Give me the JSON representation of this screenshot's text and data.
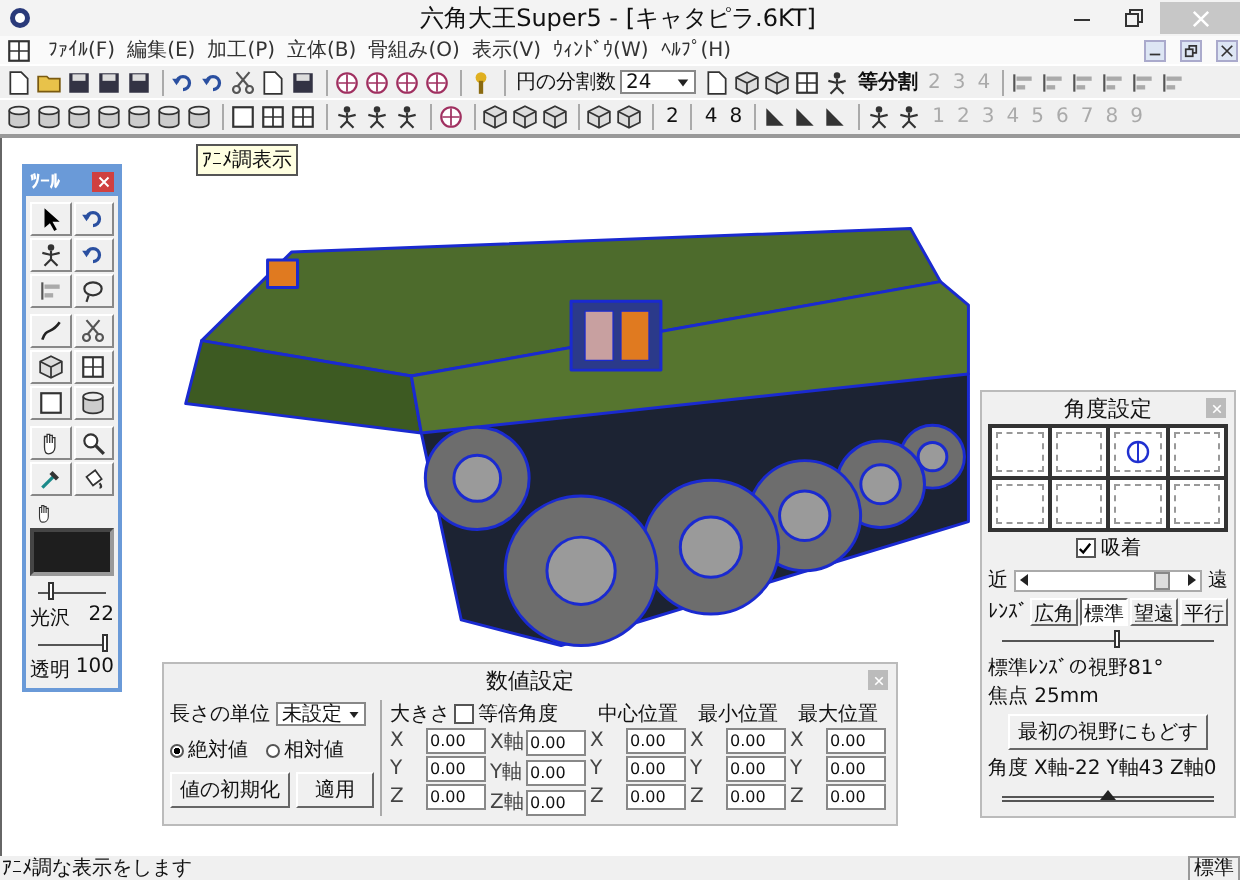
{
  "window": {
    "title": "六角大王Super5 - [キャタピラ.6KT]"
  },
  "menu": [
    "ﾌｧｲﾙ(F)",
    "編集(E)",
    "加工(P)",
    "立体(B)",
    "骨組み(O)",
    "表示(V)",
    "ｳｨﾝﾄﾞｳ(W)",
    "ﾍﾙﾌﾟ(H)"
  ],
  "toolbar_1": {
    "division_label": "円の分割数",
    "division_value": "24",
    "equal_split_label": "等分割",
    "split_buttons": [
      {
        "label": "2",
        "disabled": true
      },
      {
        "label": "3",
        "disabled": true
      },
      {
        "label": "4",
        "disabled": true
      }
    ]
  },
  "toolbar_2": {
    "count_buttons": [
      {
        "label": "2",
        "disabled": false
      },
      {
        "label": "4",
        "disabled": false
      },
      {
        "label": "8",
        "disabled": false
      }
    ],
    "number_buttons": [
      {
        "label": "1",
        "disabled": true
      },
      {
        "label": "2",
        "disabled": true
      },
      {
        "label": "3",
        "disabled": true
      },
      {
        "label": "4",
        "disabled": true
      },
      {
        "label": "5",
        "disabled": true
      },
      {
        "label": "6",
        "disabled": true
      },
      {
        "label": "7",
        "disabled": true
      },
      {
        "label": "8",
        "disabled": true
      },
      {
        "label": "9",
        "disabled": true
      }
    ]
  },
  "tooltip": "ｱﾆﾒ調表示",
  "tool_palette": {
    "title": "ﾂｰﾙ",
    "sliders": [
      {
        "label": "光沢",
        "reading": "22",
        "level": 0.22
      },
      {
        "label": "透明",
        "reading": "100",
        "level": 1
      }
    ]
  },
  "numeric_dialog": {
    "title": "数値設定",
    "unit_label": "長さの単位",
    "unit_value": "未設定",
    "modes": [
      {
        "label": "絶対値",
        "selected": true
      },
      {
        "label": "相対値",
        "selected": false
      }
    ],
    "buttons": [
      "値の初期化",
      "適用"
    ],
    "uniform_scale": {
      "label": "等倍",
      "checked": false
    },
    "columns": [
      {
        "header": "大きさ",
        "fields": [
          {
            "axis": "X",
            "value": "0.00"
          },
          {
            "axis": "Y",
            "value": "0.00"
          },
          {
            "axis": "Z",
            "value": "0.00"
          }
        ]
      },
      {
        "header": "角度",
        "fields": [
          {
            "axis": "X軸",
            "value": "0.00"
          },
          {
            "axis": "Y軸",
            "value": "0.00"
          },
          {
            "axis": "Z軸",
            "value": "0.00"
          }
        ]
      },
      {
        "header": "中心位置",
        "fields": [
          {
            "axis": "X",
            "value": "0.00"
          },
          {
            "axis": "Y",
            "value": "0.00"
          },
          {
            "axis": "Z",
            "value": "0.00"
          }
        ]
      },
      {
        "header": "最小位置",
        "fields": [
          {
            "axis": "X",
            "value": "0.00"
          },
          {
            "axis": "Y",
            "value": "0.00"
          },
          {
            "axis": "Z",
            "value": "0.00"
          }
        ]
      },
      {
        "header": "最大位置",
        "fields": [
          {
            "axis": "X",
            "value": "0.00"
          },
          {
            "axis": "Y",
            "value": "0.00"
          },
          {
            "axis": "Z",
            "value": "0.00"
          }
        ]
      }
    ]
  },
  "angle_dialog": {
    "title": "角度設定",
    "views": [
      {
        "selected": false
      },
      {
        "selected": false
      },
      {
        "selected": true
      },
      {
        "selected": false
      },
      {
        "selected": false
      },
      {
        "selected": false
      },
      {
        "selected": false
      },
      {
        "selected": false
      }
    ],
    "snap": {
      "label": "吸着",
      "checked": true
    },
    "near_label": "近",
    "far_label": "遠",
    "distance_slider": {
      "level": 0.9
    },
    "lens_label": "ﾚﾝｽﾞ",
    "lenses": [
      {
        "label": "広角",
        "selected": false
      },
      {
        "label": "標準",
        "selected": true
      },
      {
        "label": "望遠",
        "selected": false
      },
      {
        "label": "平行",
        "selected": false
      }
    ],
    "lens_slider": {
      "level": 0.55
    },
    "view_info": "標準ﾚﾝｽﾞの視野81°",
    "focal_info": "焦点 25mm",
    "reset_button": "最初の視野にもどす",
    "angle_label": "角度",
    "angles": [
      "X軸-22",
      "Y軸43",
      "Z軸0"
    ],
    "rotation_slider": {
      "level": 0.5
    }
  },
  "status_bar": {
    "message": "ｱﾆﾒ調な表示をします",
    "mode": "標準"
  }
}
